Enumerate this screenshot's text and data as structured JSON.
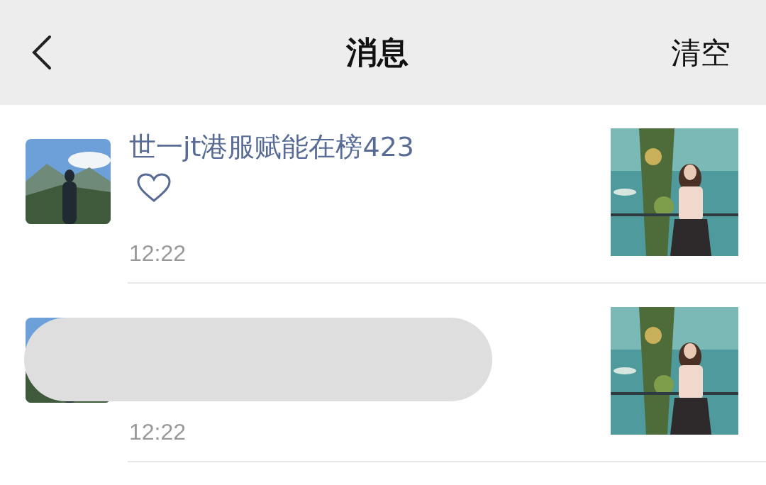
{
  "header": {
    "title": "消息",
    "action": "清空"
  },
  "messages": [
    {
      "name": "世一jt港服赋能在榜423",
      "kind": "like",
      "time": "12:22",
      "redacted": false
    },
    {
      "kind": "hidden",
      "time": "12:22",
      "redacted": true
    }
  ]
}
